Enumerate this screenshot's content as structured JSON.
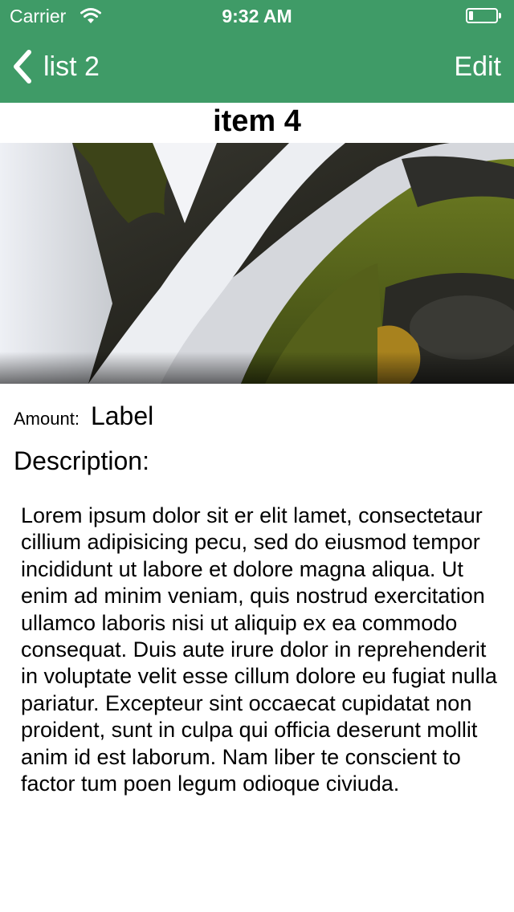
{
  "status_bar": {
    "carrier": "Carrier",
    "time": "9:32 AM",
    "wifi_icon": "wifi-icon",
    "battery_icon": "battery-icon"
  },
  "nav": {
    "back_label": "list 2",
    "back_icon": "chevron-left-icon",
    "edit_label": "Edit",
    "background_color": "#3f9b67"
  },
  "item": {
    "title": "item 4",
    "image_description": "waterfall-over-mossy-rocks",
    "amount_label": "Amount:",
    "amount_value": "Label",
    "description_label": "Description:",
    "description_text": "Lorem ipsum dolor sit er elit lamet, consectetaur cillium adipisicing pecu, sed do eiusmod tempor incididunt ut labore et dolore magna aliqua. Ut enim ad minim veniam, quis nostrud exercitation ullamco laboris nisi ut aliquip ex ea commodo consequat. Duis aute irure dolor in reprehenderit in voluptate velit esse cillum dolore eu fugiat nulla pariatur. Excepteur sint occaecat cupidatat non proident, sunt in culpa qui officia deserunt mollit anim id est laborum. Nam liber te conscient to factor tum poen legum odioque civiuda."
  }
}
